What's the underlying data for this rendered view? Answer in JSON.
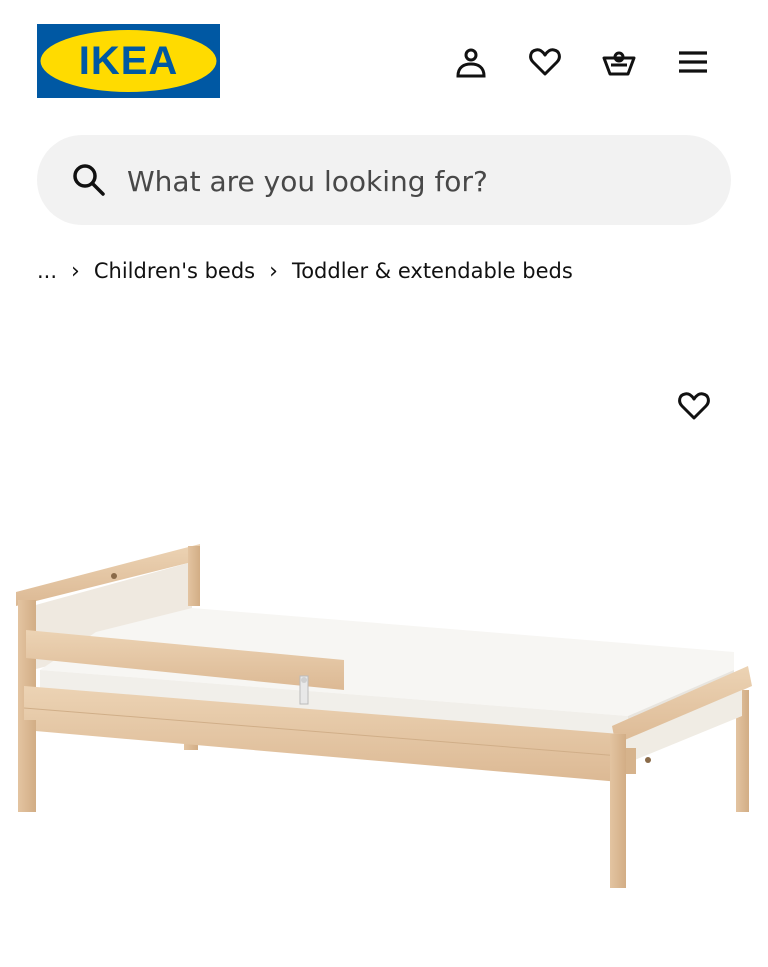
{
  "header": {
    "logo_text": "IKEA",
    "logo_colors": {
      "background": "#0058a3",
      "oval": "#ffdb00",
      "text": "#0058a3"
    },
    "icons": [
      "person-icon",
      "heart-icon",
      "basket-icon",
      "hamburger-menu-icon"
    ]
  },
  "search": {
    "placeholder": "What are you looking for?",
    "value": "",
    "icon": "search-icon"
  },
  "breadcrumb": {
    "items": [
      "...",
      "Children's beds",
      "Toddler & extendable beds"
    ],
    "separator": "›"
  },
  "product": {
    "favourite_icon": "heart-icon",
    "image": "wooden-toddler-bed"
  }
}
